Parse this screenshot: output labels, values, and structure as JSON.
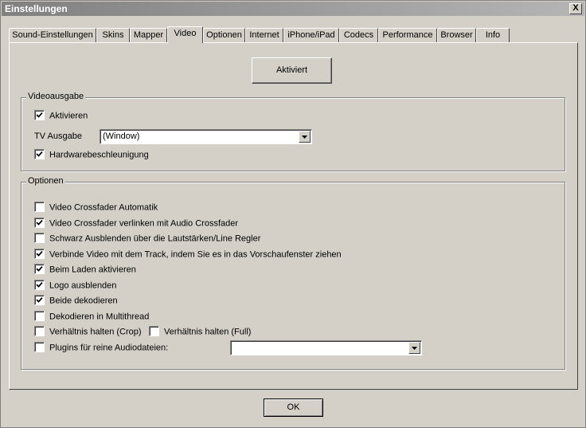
{
  "window": {
    "title": "Einstellungen",
    "close": "X"
  },
  "tabs": [
    {
      "label": "Sound-Einstellungen"
    },
    {
      "label": "Skins"
    },
    {
      "label": "Mapper"
    },
    {
      "label": "Video"
    },
    {
      "label": "Optionen"
    },
    {
      "label": "Internet"
    },
    {
      "label": "iPhone/iPad"
    },
    {
      "label": "Codecs"
    },
    {
      "label": "Performance"
    },
    {
      "label": "Browser"
    },
    {
      "label": "Info"
    }
  ],
  "active_tab": "Video",
  "activate_button": "Aktiviert",
  "videoausgabe": {
    "title": "Videoausgabe",
    "activate": {
      "label": "Aktivieren",
      "checked": true
    },
    "tv_label": "TV Ausgabe",
    "tv_value": "(Window)",
    "hardware": {
      "label": "Hardwarebeschleunigung",
      "checked": true
    }
  },
  "optionen": {
    "title": "Optionen",
    "items": [
      {
        "label": "Video Crossfader Automatik",
        "checked": false
      },
      {
        "label": "Video Crossfader verlinken mit Audio Crossfader",
        "checked": true
      },
      {
        "label": "Schwarz Ausblenden über die Lautstärken/Line Regler",
        "checked": false
      },
      {
        "label": "Verbinde Video mit dem Track, indem Sie es in das Vorschaufenster ziehen",
        "checked": true
      },
      {
        "label": "Beim Laden aktivieren",
        "checked": true
      },
      {
        "label": "Logo ausblenden",
        "checked": true
      },
      {
        "label": "Beide dekodieren",
        "checked": true
      },
      {
        "label": "Dekodieren in Multithread",
        "checked": false
      }
    ],
    "crop": {
      "label": "Verhältnis halten (Crop)",
      "checked": false
    },
    "full": {
      "label": "Verhältnis halten (Full)",
      "checked": false
    },
    "plugins": {
      "label": "Plugins für reine Audiodateien:",
      "checked": false
    },
    "plugins_value": ""
  },
  "ok_button": "OK"
}
